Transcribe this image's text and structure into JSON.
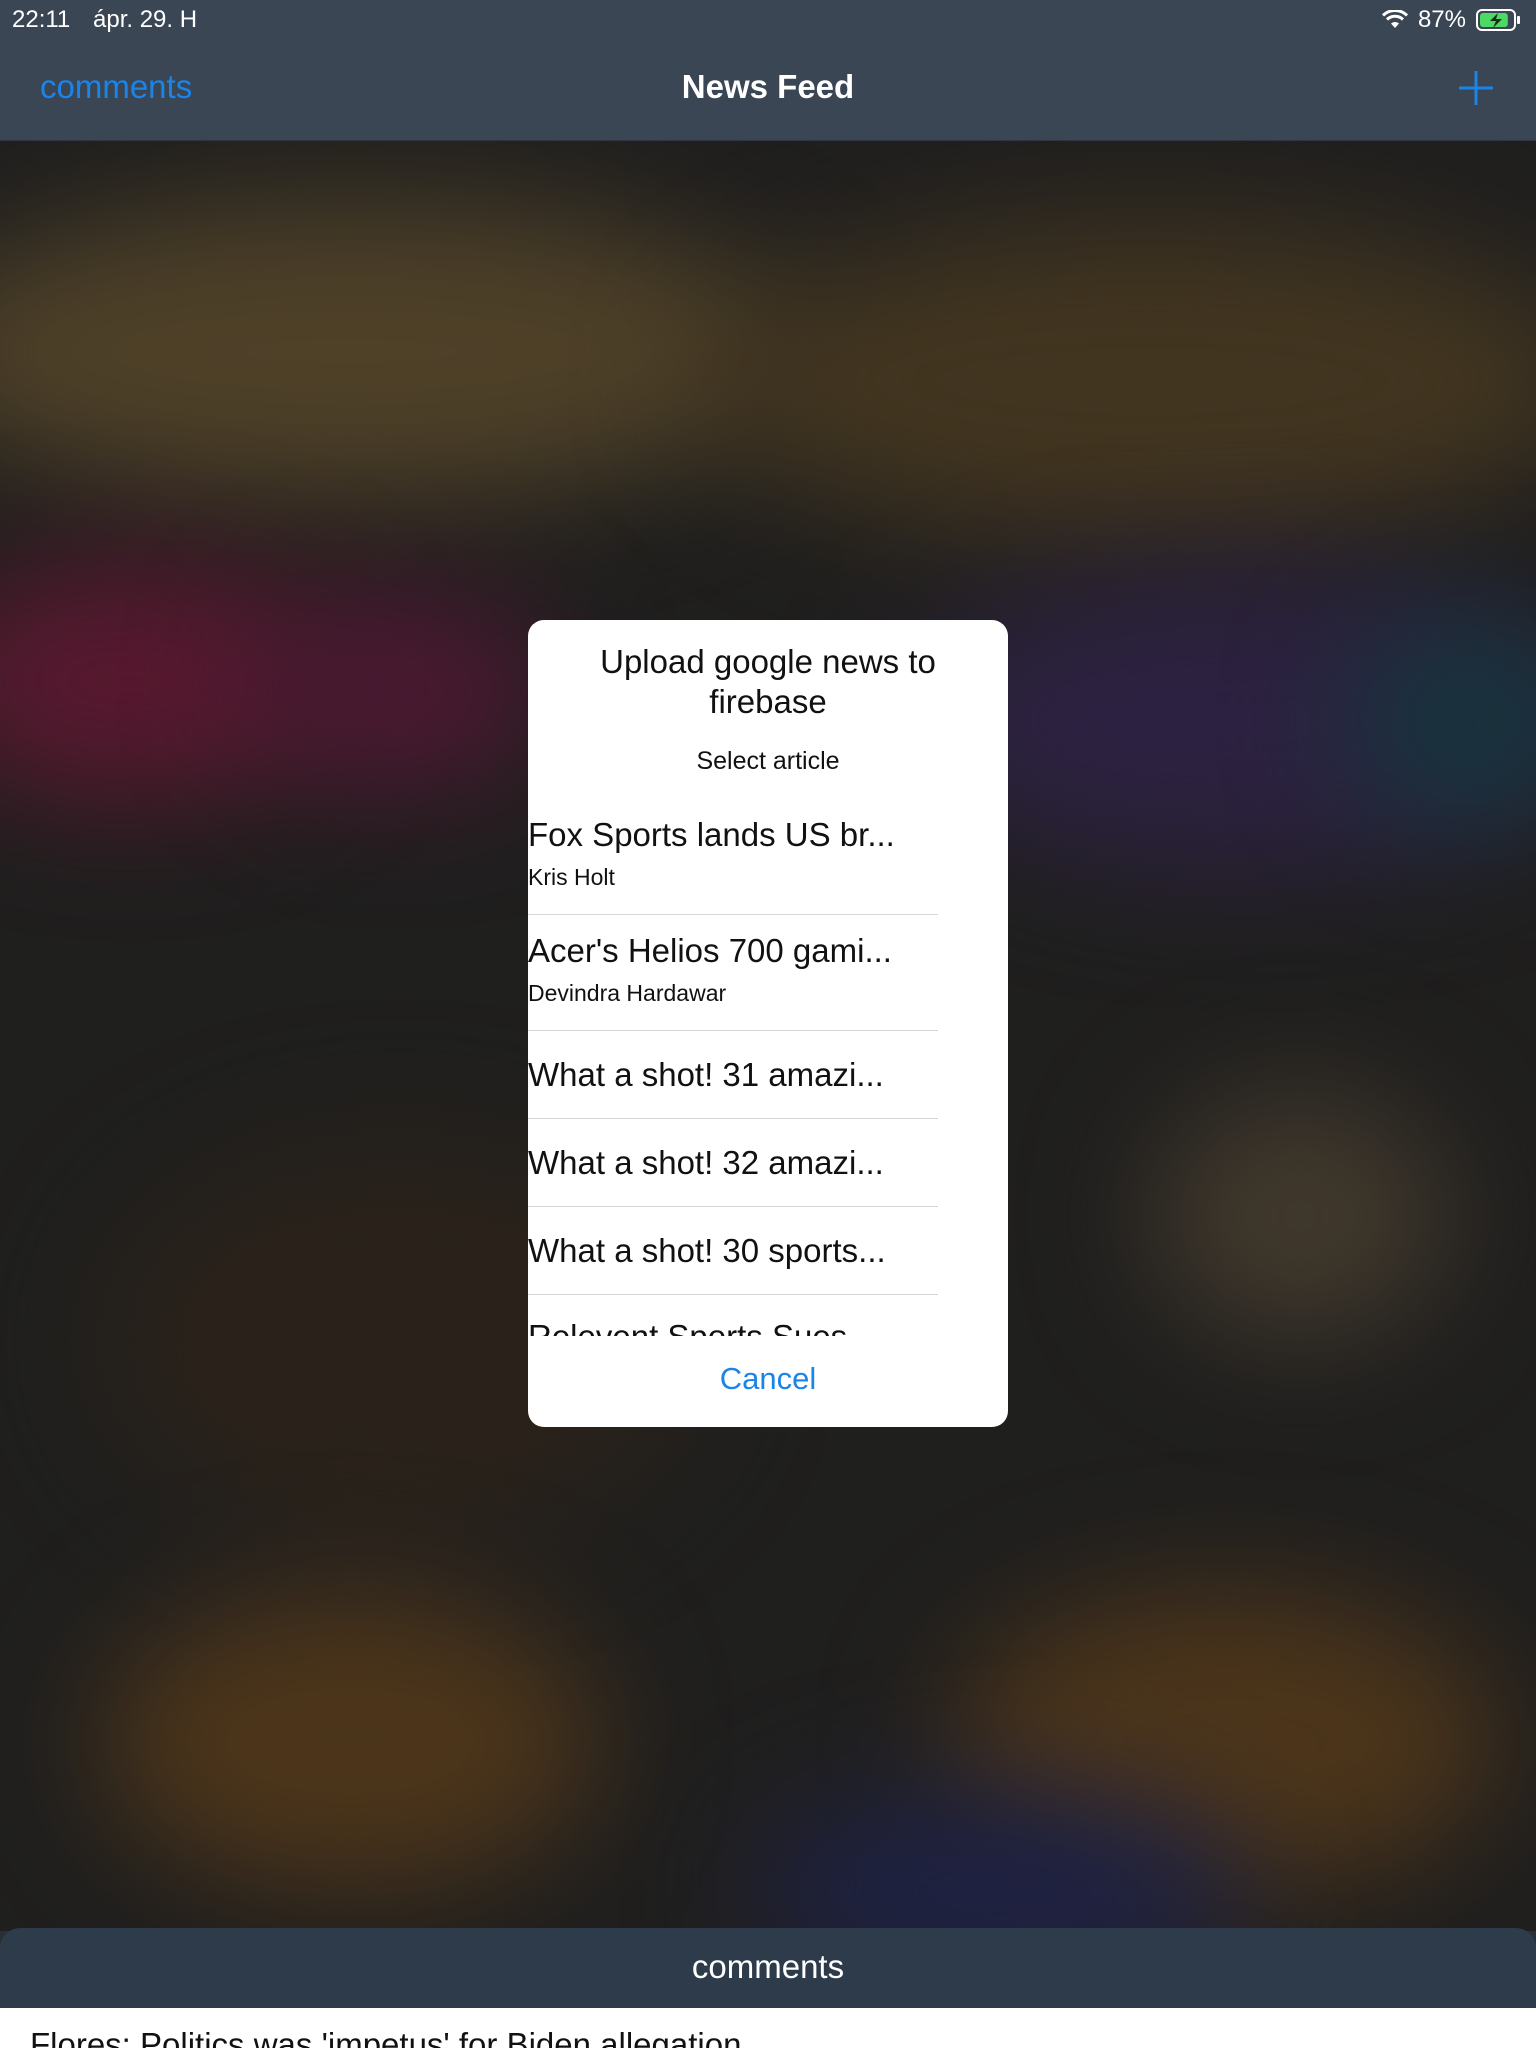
{
  "status_bar": {
    "time": "22:11",
    "date": "ápr. 29. H",
    "battery_percent": "87%",
    "battery_level": 0.87,
    "charging": true
  },
  "nav": {
    "left_label": "comments",
    "title": "News Feed",
    "right_icon": "plus-icon"
  },
  "dialog": {
    "title": "Upload google news to firebase",
    "message": "Select article",
    "articles": [
      {
        "title": "Fox Sports lands US br...",
        "author": "Kris Holt"
      },
      {
        "title": "Acer's Helios 700 gami...",
        "author": "Devindra Hardawar"
      },
      {
        "title": "What a shot! 31 amazi...",
        "author": ""
      },
      {
        "title": "What a shot! 32 amazi...",
        "author": ""
      },
      {
        "title": "What a shot! 30 sports...",
        "author": ""
      },
      {
        "title": "Relevent Sports Sues",
        "author": ""
      }
    ],
    "cancel_label": "Cancel"
  },
  "bottom": {
    "label": "comments",
    "headline": "Flores: Politics was 'impetus' for Biden allegation"
  },
  "colors": {
    "accent": "#1b84e8",
    "bar": "#3a4654",
    "battery_green": "#4cd964"
  }
}
